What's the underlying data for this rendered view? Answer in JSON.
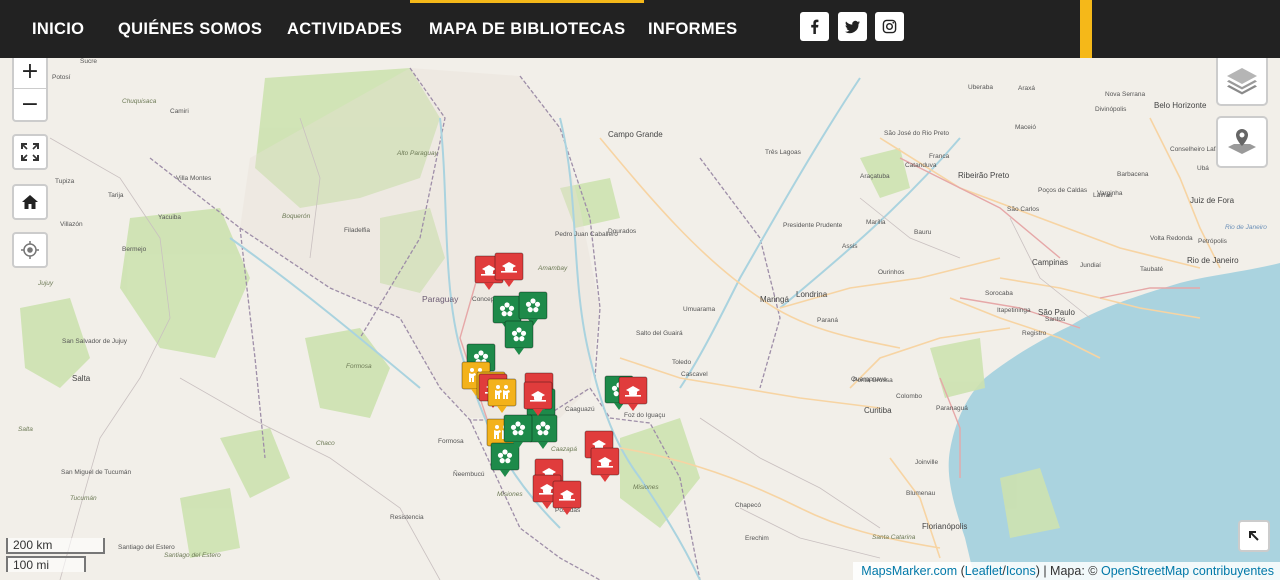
{
  "nav": {
    "items": [
      {
        "label": "INICIO",
        "active": false
      },
      {
        "label": "QUIÉNES SOMOS",
        "active": false
      },
      {
        "label": "ACTIVIDADES",
        "active": false
      },
      {
        "label": "MAPA DE BIBLIOTECAS",
        "active": true
      },
      {
        "label": "INFORMES",
        "active": false
      }
    ],
    "social": [
      "facebook-icon",
      "twitter-icon",
      "instagram-icon"
    ],
    "accent_color": "#f5b819",
    "background": "#222222"
  },
  "map": {
    "controls": {
      "zoom_in": "+",
      "zoom_out": "−",
      "fullscreen": "fullscreen-icon",
      "home": "home-icon",
      "locate": "locate-icon",
      "layers": "layers-icon",
      "markers_layer": "map-pin-layer-icon",
      "expand": "expand-arrow-icon"
    },
    "scale": {
      "metric": "200 km",
      "imperial": "100 mi"
    },
    "attribution": {
      "link1": "MapsMarker.com",
      "paren_open": " (",
      "link2": "Leaflet",
      "slash": "/",
      "link3": "Icons",
      "mid": ") | Mapa: © ",
      "link4": "OpenStreetMap contribuyentes"
    },
    "marker_colors": {
      "red": "#e03c3c",
      "green": "#1e8a4a",
      "yellow": "#f3b21b"
    },
    "places": [
      {
        "t": "Sucre"
      },
      {
        "t": "Potosí"
      },
      {
        "t": "Chuquisaca"
      },
      {
        "t": "Camiri"
      },
      {
        "t": "Villa Montes"
      },
      {
        "t": "Tarija"
      },
      {
        "t": "Tupiza"
      },
      {
        "t": "Yacuiba"
      },
      {
        "t": "Villazón"
      },
      {
        "t": "Bermejo"
      },
      {
        "t": "Jujuy"
      },
      {
        "t": "San Salvador de Jujuy"
      },
      {
        "t": "Salta"
      },
      {
        "t": "Salta"
      },
      {
        "t": "San Miguel de Tucumán"
      },
      {
        "t": "Tucumán"
      },
      {
        "t": "Santiago del Estero"
      },
      {
        "t": "Santiago del Estero"
      },
      {
        "t": "Formosa"
      },
      {
        "t": "Formosa"
      },
      {
        "t": "Chaco"
      },
      {
        "t": "Resistencia"
      },
      {
        "t": "Ñeembucú"
      },
      {
        "t": "Misiones"
      },
      {
        "t": "Misiones"
      },
      {
        "t": "Posadas"
      },
      {
        "t": "Alto Paraguay"
      },
      {
        "t": "Boquerón"
      },
      {
        "t": "Filadelfia"
      },
      {
        "t": "Paraguay"
      },
      {
        "t": "Concepción"
      },
      {
        "t": "Amambay"
      },
      {
        "t": "Pedro Juan Caballero"
      },
      {
        "t": "Dourados"
      },
      {
        "t": "Campo Grande"
      },
      {
        "t": "Caaguazú"
      },
      {
        "t": "Caazapá"
      },
      {
        "t": "Foz do Iguaçu"
      },
      {
        "t": "Salto del Guairá"
      },
      {
        "t": "Toledo"
      },
      {
        "t": "Cascavel"
      },
      {
        "t": "Umuarama"
      },
      {
        "t": "Maringá"
      },
      {
        "t": "Londrina"
      },
      {
        "t": "Paraná"
      },
      {
        "t": "Guarapuava"
      },
      {
        "t": "Ponta Grossa"
      },
      {
        "t": "Curitiba"
      },
      {
        "t": "Joinville"
      },
      {
        "t": "Blumenau"
      },
      {
        "t": "Florianópolis"
      },
      {
        "t": "Chapecó"
      },
      {
        "t": "Santa Catarina"
      },
      {
        "t": "Erechim"
      },
      {
        "t": "São Paulo"
      },
      {
        "t": "Campinas"
      },
      {
        "t": "Santos"
      },
      {
        "t": "Sorocaba"
      },
      {
        "t": "Ribeirão Preto"
      },
      {
        "t": "São José do Rio Preto"
      },
      {
        "t": "Três Lagoas"
      },
      {
        "t": "Presidente Prudente"
      },
      {
        "t": "Marília"
      },
      {
        "t": "Bauru"
      },
      {
        "t": "Araçatuba"
      },
      {
        "t": "Uberaba"
      },
      {
        "t": "Araxá"
      },
      {
        "t": "Nova Serrana"
      },
      {
        "t": "Belo Horizonte"
      },
      {
        "t": "Divinópolis"
      },
      {
        "t": "Juiz de Fora"
      },
      {
        "t": "Rio de Janeiro"
      },
      {
        "t": "Petrópolis"
      },
      {
        "t": "Volta Redonda"
      },
      {
        "t": "Barbacena"
      },
      {
        "t": "Lavras"
      },
      {
        "t": "Varginha"
      },
      {
        "t": "Poços de Caldas"
      },
      {
        "t": "São Carlos"
      },
      {
        "t": "Franca"
      },
      {
        "t": "Catanduva"
      },
      {
        "t": "Jundiaí"
      },
      {
        "t": "Taubaté"
      },
      {
        "t": "Ubá"
      },
      {
        "t": "Rio de Janeiro"
      },
      {
        "t": "Conselheiro Lafaiete"
      },
      {
        "t": "Assis"
      },
      {
        "t": "Ourinhos"
      },
      {
        "t": "Itapetininga"
      },
      {
        "t": "Registro"
      },
      {
        "t": "Paranaguá"
      },
      {
        "t": "Colombo"
      },
      {
        "t": "Maceió"
      }
    ],
    "markers": [
      {
        "c": "red"
      },
      {
        "c": "red"
      },
      {
        "c": "green"
      },
      {
        "c": "green"
      },
      {
        "c": "green"
      },
      {
        "c": "green"
      },
      {
        "c": "yellow"
      },
      {
        "c": "yellow"
      },
      {
        "c": "red"
      },
      {
        "c": "yellow"
      },
      {
        "c": "red"
      },
      {
        "c": "green"
      },
      {
        "c": "green"
      },
      {
        "c": "yellow"
      },
      {
        "c": "green"
      },
      {
        "c": "green"
      },
      {
        "c": "red"
      },
      {
        "c": "green"
      },
      {
        "c": "red"
      },
      {
        "c": "red"
      },
      {
        "c": "red"
      },
      {
        "c": "red"
      },
      {
        "c": "red"
      },
      {
        "c": "red"
      }
    ]
  }
}
